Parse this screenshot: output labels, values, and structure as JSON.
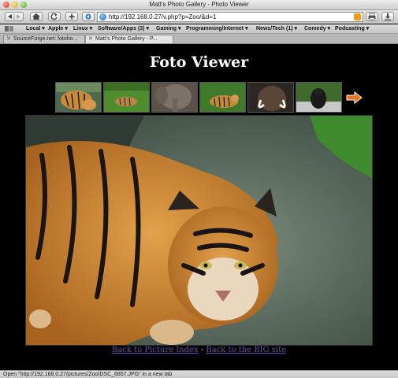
{
  "window": {
    "title": "Matt's Photo Gallery - Photo Viewer"
  },
  "toolbar": {
    "url": "http://192.168.0.27/v.php?p=Zoo/&d=1"
  },
  "bookmarks": [
    {
      "label": "Local ▾"
    },
    {
      "label": "Apple ▾"
    },
    {
      "label": "Linux ▾"
    },
    {
      "label": "Software/Apps (3) ▾"
    },
    {
      "label": "Gaming ▾"
    },
    {
      "label": "Programming/Internet ▾"
    },
    {
      "label": "News/Tech (1) ▾"
    },
    {
      "label": "Comedy ▾"
    },
    {
      "label": "Podcasting ▾"
    }
  ],
  "tabs": [
    {
      "label": "SourceForge.net: fotoho..."
    },
    {
      "label": "Matt's Photo Gallery - P..."
    }
  ],
  "page": {
    "title": "Foto Viewer",
    "thumbnails": [
      {
        "icon": "tiger-thumbnail"
      },
      {
        "icon": "tiger-on-grass-thumbnail"
      },
      {
        "icon": "elephant-thumbnail"
      },
      {
        "icon": "tiger-resting-thumbnail"
      },
      {
        "icon": "mammoth-thumbnail"
      },
      {
        "icon": "gorilla-thumbnail"
      }
    ],
    "next_icon": "next-arrow-icon",
    "link_index": "Back to Picture Index",
    "link_separator": " - ",
    "link_big": "Back to the BIG site"
  },
  "status": {
    "text": "Open \"http://192.168.0.27/pictures/Zoo/DSC_6857.JPG\" in a new tab"
  },
  "colors": {
    "page_bg": "#000000",
    "link": "#6b4ea6",
    "arrow": "#e8731e"
  }
}
